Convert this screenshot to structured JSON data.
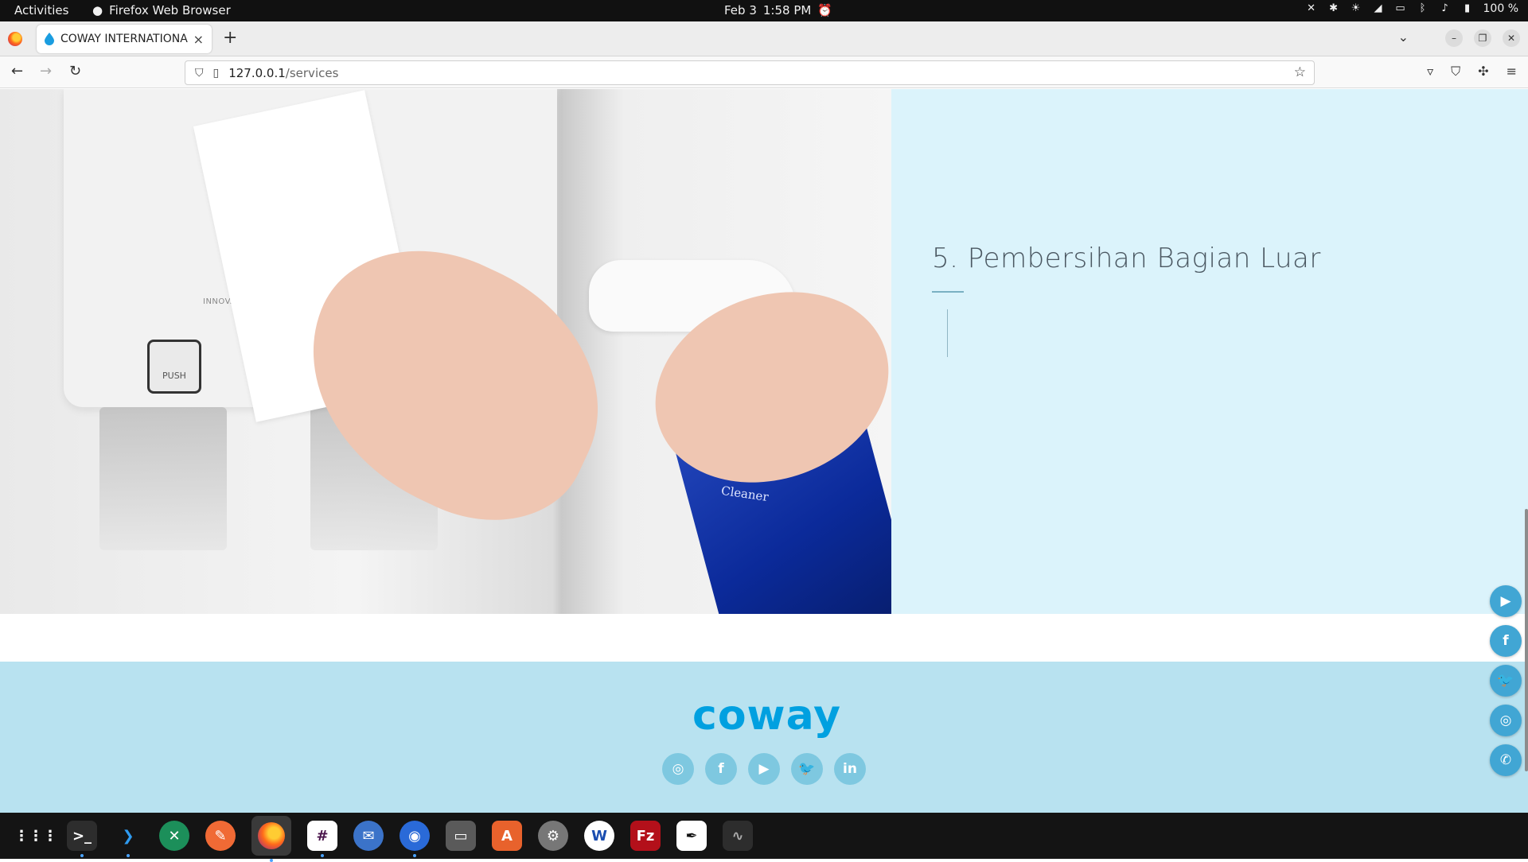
{
  "system": {
    "activities": "Activities",
    "app_name": "Firefox Web Browser",
    "date": "Feb 3",
    "time": "1:58 PM",
    "battery": "100 %"
  },
  "browser": {
    "tab_title": "COWAY INTERNATIONAL",
    "url_host": "127.0.0.1",
    "url_path": "/services"
  },
  "page": {
    "image_text": {
      "dispenser_label": "INNOVATIVE WATER FILT",
      "push_label": "PUSH",
      "bottle_label": "Cleaner"
    },
    "step_title": "5. Pembersihan Bagian Luar"
  },
  "footer": {
    "logo": "coway",
    "socials": [
      "instagram-icon",
      "facebook-icon",
      "youtube-icon",
      "twitter-icon",
      "linkedin-icon"
    ]
  },
  "floating_socials": [
    "youtube-icon",
    "facebook-icon",
    "twitter-icon",
    "instagram-icon",
    "whatsapp-icon"
  ],
  "colors": {
    "info_panel_bg": "#dbf3fb",
    "footer_bg": "#b8e2f0",
    "brand": "#00a0e0"
  }
}
